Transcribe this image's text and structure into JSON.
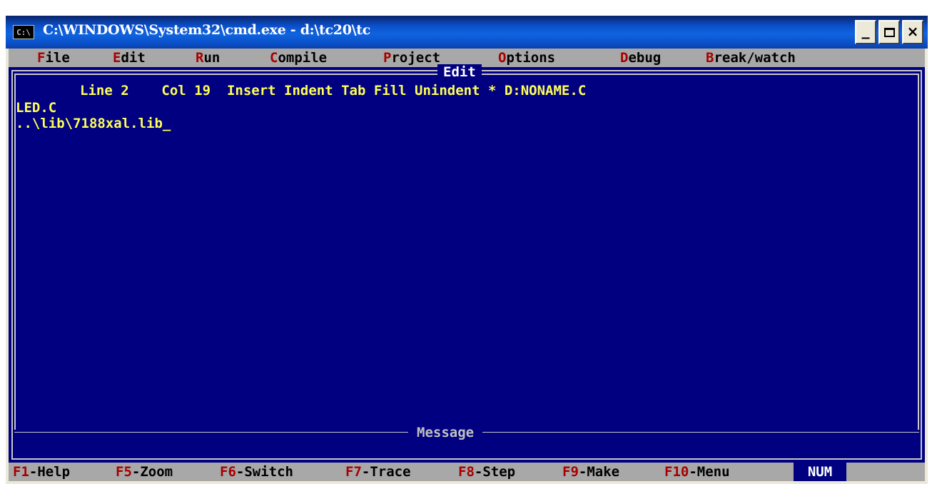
{
  "window": {
    "title": "C:\\WINDOWS\\System32\\cmd.exe - d:\\tc20\\tc",
    "icon_text": "C:\\",
    "icon": "console-icon",
    "minimize_label": "_",
    "close_label": "×"
  },
  "menu": [
    {
      "hot": "F",
      "rest": "ile"
    },
    {
      "hot": "E",
      "rest": "dit"
    },
    {
      "hot": "R",
      "rest": "un"
    },
    {
      "hot": "C",
      "rest": "ompile"
    },
    {
      "hot": "P",
      "rest": "roject"
    },
    {
      "hot": "O",
      "rest": "ptions"
    },
    {
      "hot": "D",
      "rest": "ebug"
    },
    {
      "hot": "B",
      "rest": "reak/watch"
    }
  ],
  "editor": {
    "frame_title": "Edit",
    "status": {
      "line": "Line 2",
      "col": "Col 19",
      "flags": "Insert Indent Tab Fill Unindent * D:NONAME.C"
    },
    "lines": [
      "LED.C",
      "..\\lib\\7188xal.lib"
    ],
    "cursor": "_"
  },
  "message_panel": {
    "title": "Message"
  },
  "function_keys": [
    {
      "key": "F1",
      "label": "-Help"
    },
    {
      "key": "F5",
      "label": "-Zoom"
    },
    {
      "key": "F6",
      "label": "-Switch"
    },
    {
      "key": "F7",
      "label": "-Trace"
    },
    {
      "key": "F8",
      "label": "-Step"
    },
    {
      "key": "F9",
      "label": "-Make"
    },
    {
      "key": "F10",
      "label": "-Menu"
    }
  ],
  "indicator": "NUM",
  "colors": {
    "console_background": "#000080",
    "editor_text": "#ffff55",
    "menu_background": "#a8a8a8",
    "hotkey": "#a80000",
    "titlebar_blue": "#0b4ec9"
  }
}
